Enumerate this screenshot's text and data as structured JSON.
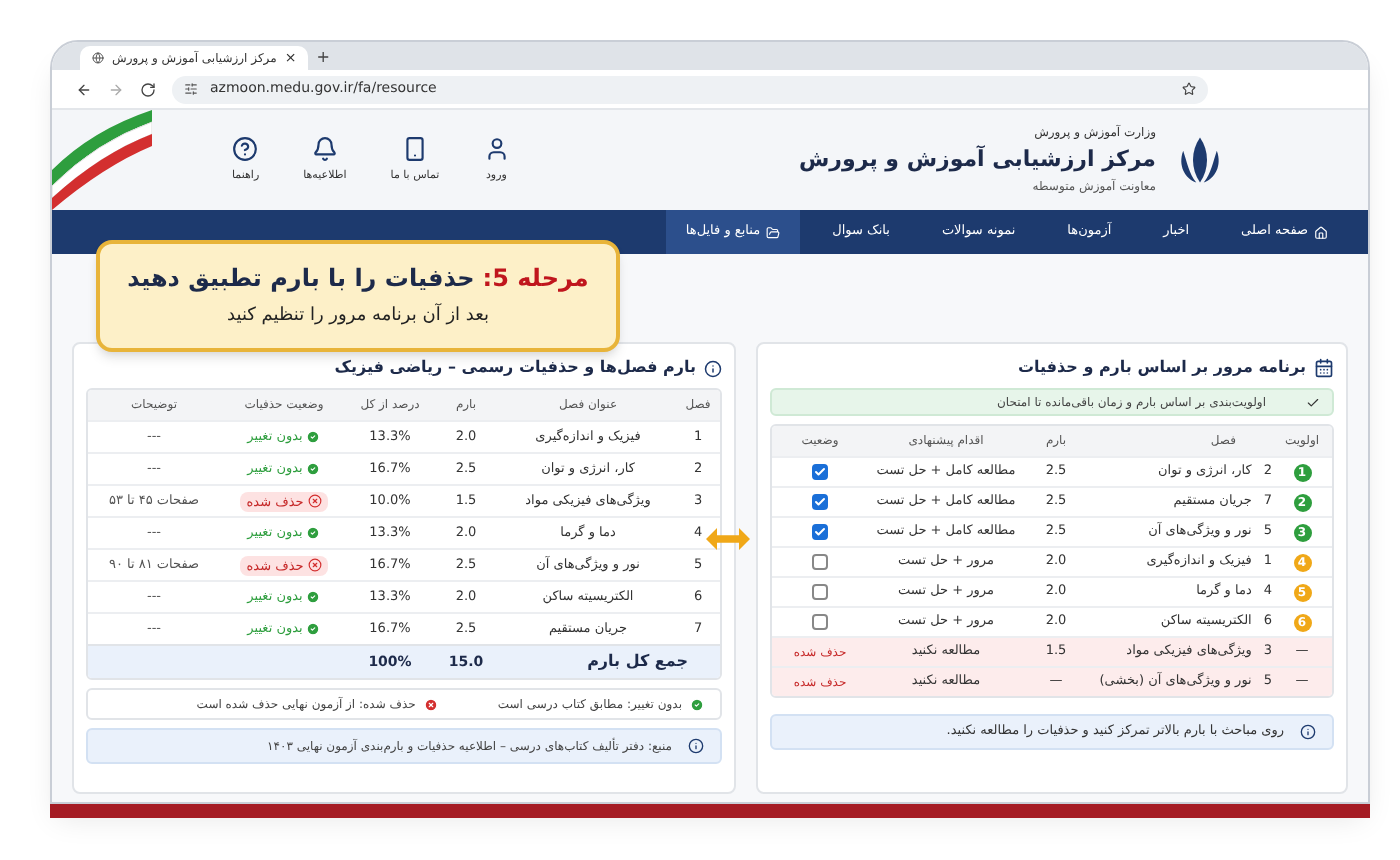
{
  "browser": {
    "tab_title": "مرکز ارزشیابی آموزش و پرورش",
    "tab_close": "×",
    "new_tab": "+",
    "url": "azmoon.medu.gov.ir/fa/resource"
  },
  "header": {
    "ministry": "وزارت آموزش و پرورش",
    "title": "مرکز ارزشیابی آموزش و پرورش",
    "subtitle": "معاونت آموزش متوسطه",
    "links": [
      {
        "label": "ورود"
      },
      {
        "label": "تماس با ما"
      },
      {
        "label": "اطلاعیه‌ها"
      },
      {
        "label": "راهنما"
      }
    ]
  },
  "nav": [
    {
      "label": "صفحه اصلی",
      "selected": false
    },
    {
      "label": "اخبار",
      "selected": false
    },
    {
      "label": "آزمون‌ها",
      "selected": false
    },
    {
      "label": "نمونه سوالات",
      "selected": false
    },
    {
      "label": "بانک سوال",
      "selected": false
    },
    {
      "label": "منابع و فایل‌ها",
      "selected": true
    }
  ],
  "callout": {
    "step": "مرحله 5:",
    "title": "حذفیات را با بارم تطبیق دهید",
    "subtitle": "بعد از آن برنامه مرور را تنظیم کنید"
  },
  "review_plan": {
    "title": "برنامه مرور بر اساس بارم و حذفیات",
    "note": "اولویت‌بندی بر اساس بارم و زمان باقی‌مانده تا امتحان",
    "columns": [
      "اولویت",
      "فصل",
      "بارم",
      "اقدام پیشنهادی",
      "وضعیت"
    ],
    "rows": [
      {
        "kind": "task",
        "priority": "1",
        "color": "#2e9e3e",
        "chapter_no": "2",
        "chapter": "کار، انرژی و توان",
        "score": "2.5",
        "action": "مطالعه کامل + حل تست",
        "checked": true
      },
      {
        "kind": "task",
        "priority": "2",
        "color": "#2e9e3e",
        "chapter_no": "7",
        "chapter": "جریان مستقیم",
        "score": "2.5",
        "action": "مطالعه کامل + حل تست",
        "checked": true
      },
      {
        "kind": "task",
        "priority": "3",
        "color": "#2e9e3e",
        "chapter_no": "5",
        "chapter": "نور و ویژگی‌های آن",
        "score": "2.5",
        "action": "مطالعه کامل + حل تست",
        "checked": true
      },
      {
        "kind": "task",
        "priority": "4",
        "color": "#f0a818",
        "chapter_no": "1",
        "chapter": "فیزیک و اندازه‌گیری",
        "score": "2.0",
        "action": "مرور + حل تست",
        "checked": false
      },
      {
        "kind": "task",
        "priority": "5",
        "color": "#f0a818",
        "chapter_no": "4",
        "chapter": "دما و گرما",
        "score": "2.0",
        "action": "مرور + حل تست",
        "checked": false
      },
      {
        "kind": "task",
        "priority": "6",
        "color": "#f0a818",
        "chapter_no": "6",
        "chapter": "الکتریسیته ساکن",
        "score": "2.0",
        "action": "مرور + حل تست",
        "checked": false
      },
      {
        "kind": "removed",
        "priority": "—",
        "chapter_no": "3",
        "chapter": "ویژگی‌های فیزیکی مواد",
        "score": "1.5",
        "action": "مطالعه نکنید",
        "status": "حذف شده"
      },
      {
        "kind": "removed",
        "priority": "—",
        "chapter_no": "5",
        "chapter": "نور و ویژگی‌های آن (بخشی)",
        "score": "—",
        "action": "مطالعه نکنید",
        "status": "حذف شده"
      }
    ],
    "tip": "روی مباحث با بارم بالاتر تمرکز کنید و حذفیات را مطالعه نکنید."
  },
  "scores": {
    "title": "بارم فصل‌ها و حذفیات رسمی – ریاضی فیزیک",
    "columns": [
      "فصل",
      "عنوان فصل",
      "بارم",
      "درصد از کل",
      "وضعیت حذفیات",
      "توضیحات"
    ],
    "rows": [
      {
        "no": "1",
        "title": "فیزیک و اندازه‌گیری",
        "score": "2.0",
        "percent": "13.3%",
        "kind": "unchanged",
        "status": "بدون تغییر",
        "note": "---"
      },
      {
        "no": "2",
        "title": "کار، انرژی و توان",
        "score": "2.5",
        "percent": "16.7%",
        "kind": "unchanged",
        "status": "بدون تغییر",
        "note": "---"
      },
      {
        "no": "3",
        "title": "ویژگی‌های فیزیکی مواد",
        "score": "1.5",
        "percent": "10.0%",
        "kind": "removed",
        "status": "حذف شده",
        "note": "صفحات ۴۵ تا ۵۳"
      },
      {
        "no": "4",
        "title": "دما و گرما",
        "score": "2.0",
        "percent": "13.3%",
        "kind": "unchanged",
        "status": "بدون تغییر",
        "note": "---"
      },
      {
        "no": "5",
        "title": "نور و ویژگی‌های آن",
        "score": "2.5",
        "percent": "16.7%",
        "kind": "removed",
        "status": "حذف شده",
        "note": "صفحات ۸۱ تا ۹۰"
      },
      {
        "no": "6",
        "title": "الکتریسیته ساکن",
        "score": "2.0",
        "percent": "13.3%",
        "kind": "unchanged",
        "status": "بدون تغییر",
        "note": "---"
      },
      {
        "no": "7",
        "title": "جریان مستقیم",
        "score": "2.5",
        "percent": "16.7%",
        "kind": "unchanged",
        "status": "بدون تغییر",
        "note": "---"
      }
    ],
    "total": {
      "label": "جمع کل بارم",
      "score": "15.0",
      "percent": "100%"
    },
    "legend": [
      "بدون تغییر: مطابق کتاب درسی است",
      "حذف شده: از آزمون نهایی حذف شده است"
    ],
    "source": "منبع: دفتر تألیف کتاب‌های درسی – اطلاعیه حذفیات و بارم‌بندی آزمون نهایی ۱۴۰۳"
  }
}
